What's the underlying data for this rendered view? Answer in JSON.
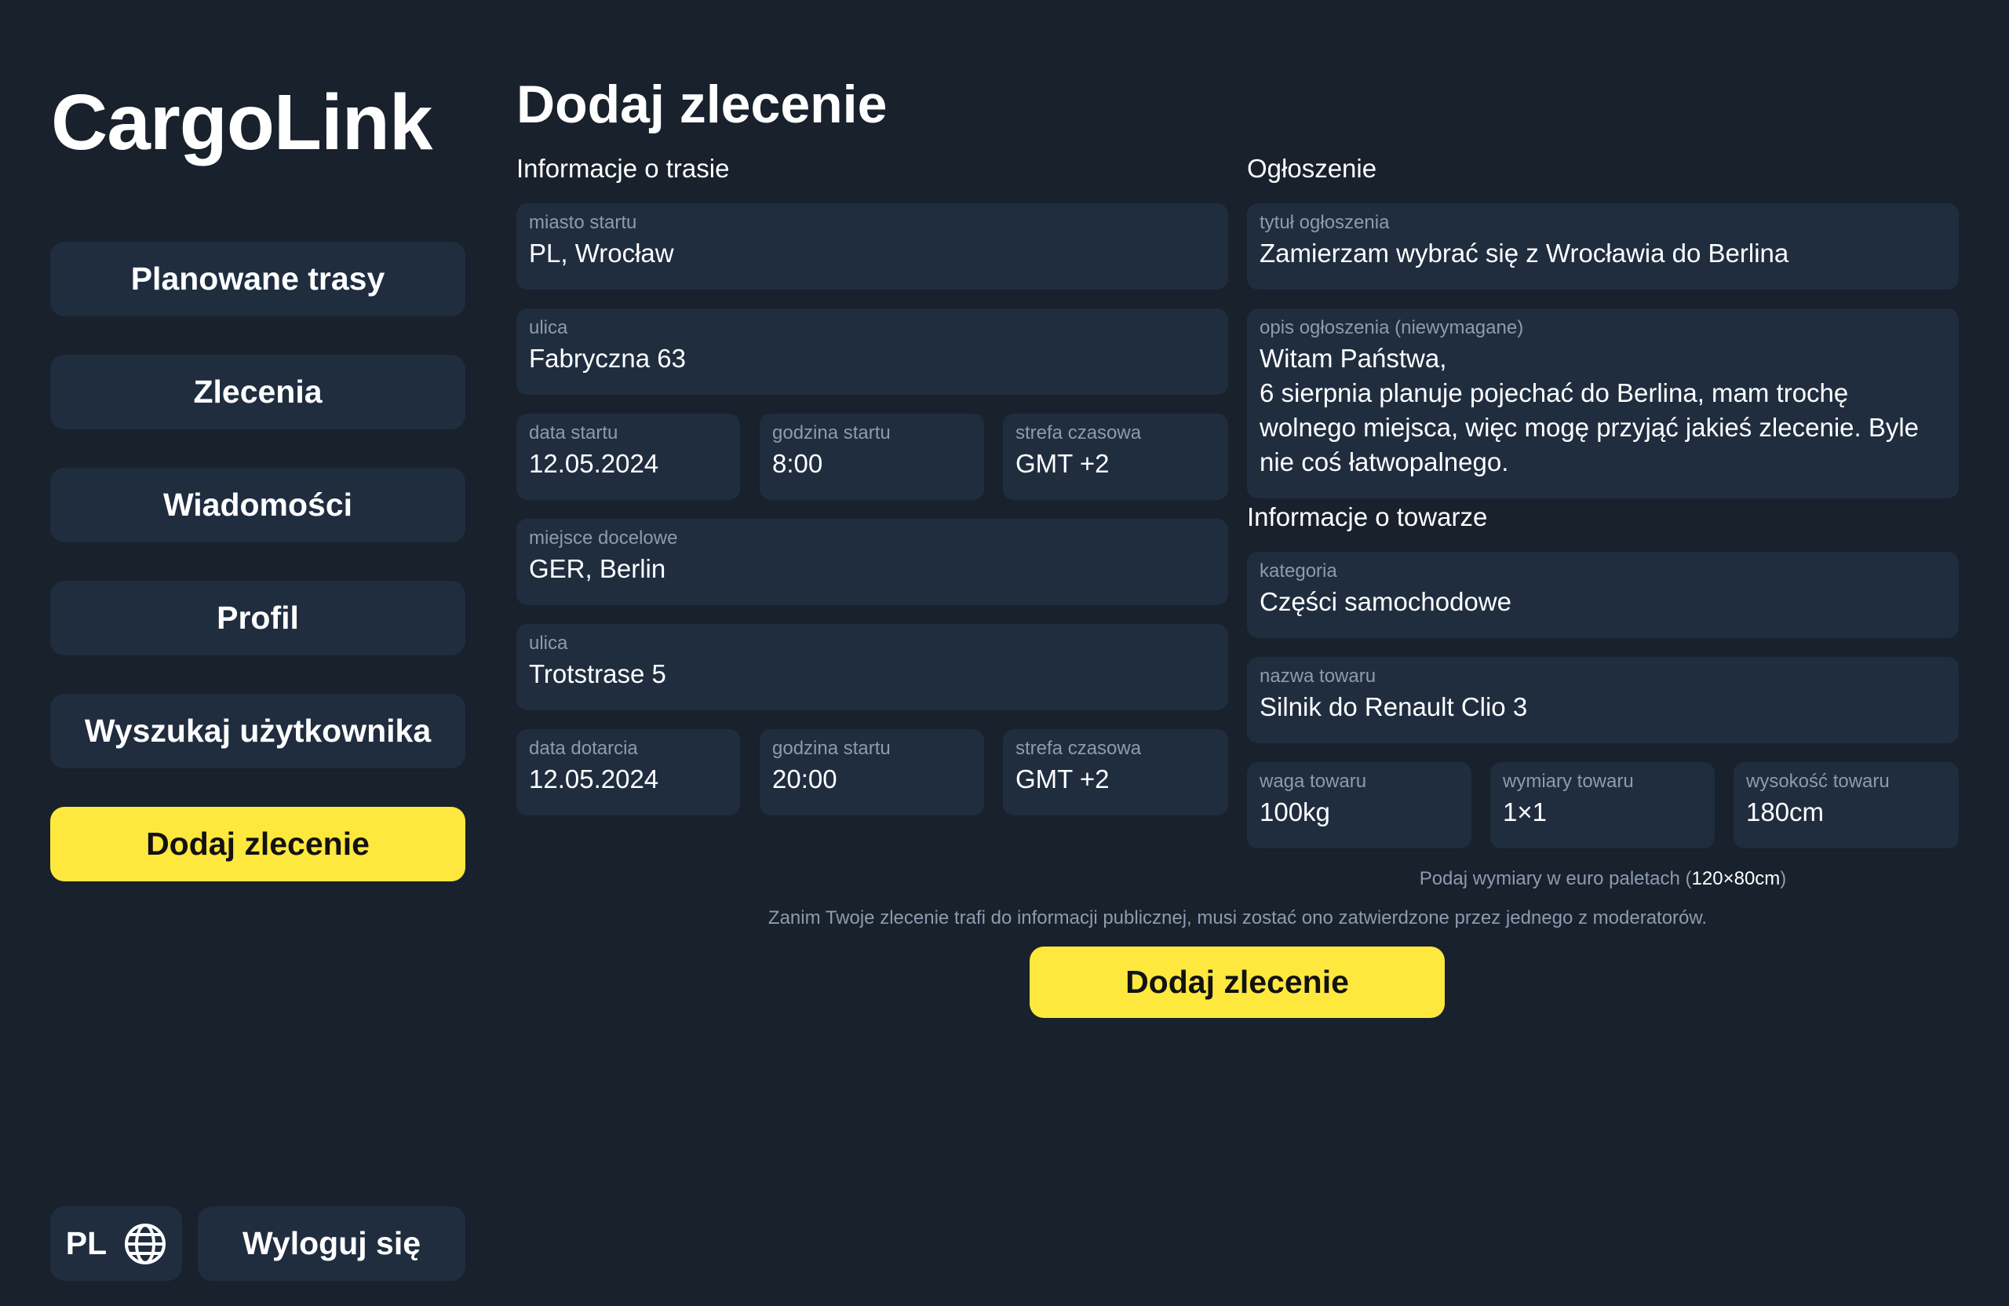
{
  "app": {
    "title": "CargoLink"
  },
  "sidebar": {
    "items": [
      {
        "label": "Planowane trasy"
      },
      {
        "label": "Zlecenia"
      },
      {
        "label": "Wiadomości"
      },
      {
        "label": "Profil"
      },
      {
        "label": "Wyszukaj użytkownika"
      },
      {
        "label": "Dodaj zlecenie",
        "active": true
      }
    ],
    "language": "PL",
    "language_icon": "globe-icon",
    "logout_label": "Wyloguj się"
  },
  "colors": {
    "background": "#18212c",
    "panel": "#1f2d3f",
    "accent": "#ffe83e",
    "muted_text": "#8d9bb0"
  },
  "page": {
    "title": "Dodaj zlecenie",
    "route_section": {
      "title": "Informacje o trasie",
      "start_city": {
        "label": "miasto startu",
        "value": "PL, Wrocław"
      },
      "start_street": {
        "label": "ulica",
        "value": "Fabryczna 63"
      },
      "start_date": {
        "label": "data startu",
        "value": "12.05.2024"
      },
      "start_time": {
        "label": "godzina startu",
        "value": "8:00"
      },
      "start_timezone": {
        "label": "strefa czasowa",
        "value": "GMT +2"
      },
      "destination": {
        "label": "miejsce docelowe",
        "value": "GER, Berlin"
      },
      "dest_street": {
        "label": "ulica",
        "value": "Trotstrase 5"
      },
      "arrival_date": {
        "label": "data dotarcia",
        "value": "12.05.2024"
      },
      "arrival_time": {
        "label": "godzina startu",
        "value": "20:00"
      },
      "arrival_timezone": {
        "label": "strefa czasowa",
        "value": "GMT +2"
      }
    },
    "ad_section": {
      "title": "Ogłoszenie",
      "ad_title": {
        "label": "tytuł ogłoszenia",
        "value": "Zamierzam wybrać się z Wrocławia do Berlina"
      },
      "ad_description": {
        "label": "opis ogłoszenia (niewymagane)",
        "value": "Witam Państwa,\n6 sierpnia planuje pojechać do Berlina, mam trochę\nwolnego miejsca, więc mogę przyjąć jakieś zlecenie. Byle\nnie coś łatwopalnego."
      }
    },
    "goods_section": {
      "title": "Informacje o towarze",
      "category": {
        "label": "kategoria",
        "value": "Części samochodowe"
      },
      "name": {
        "label": "nazwa towaru",
        "value": "Silnik do Renault Clio 3"
      },
      "weight": {
        "label": "waga towaru",
        "value": "100kg"
      },
      "dimensions": {
        "label": "wymiary towaru",
        "value": "1×1"
      },
      "height": {
        "label": "wysokość towaru",
        "value": "180cm"
      },
      "dimensions_hint_prefix": "Podaj wymiary w euro paletach (",
      "dimensions_hint_value": "120×80cm",
      "dimensions_hint_suffix": ")"
    },
    "moderation_note": "Zanim Twoje zlecenie trafi do informacji publicznej, musi zostać ono zatwierdzone przez jednego z moderatorów.",
    "submit_label": "Dodaj zlecenie"
  }
}
